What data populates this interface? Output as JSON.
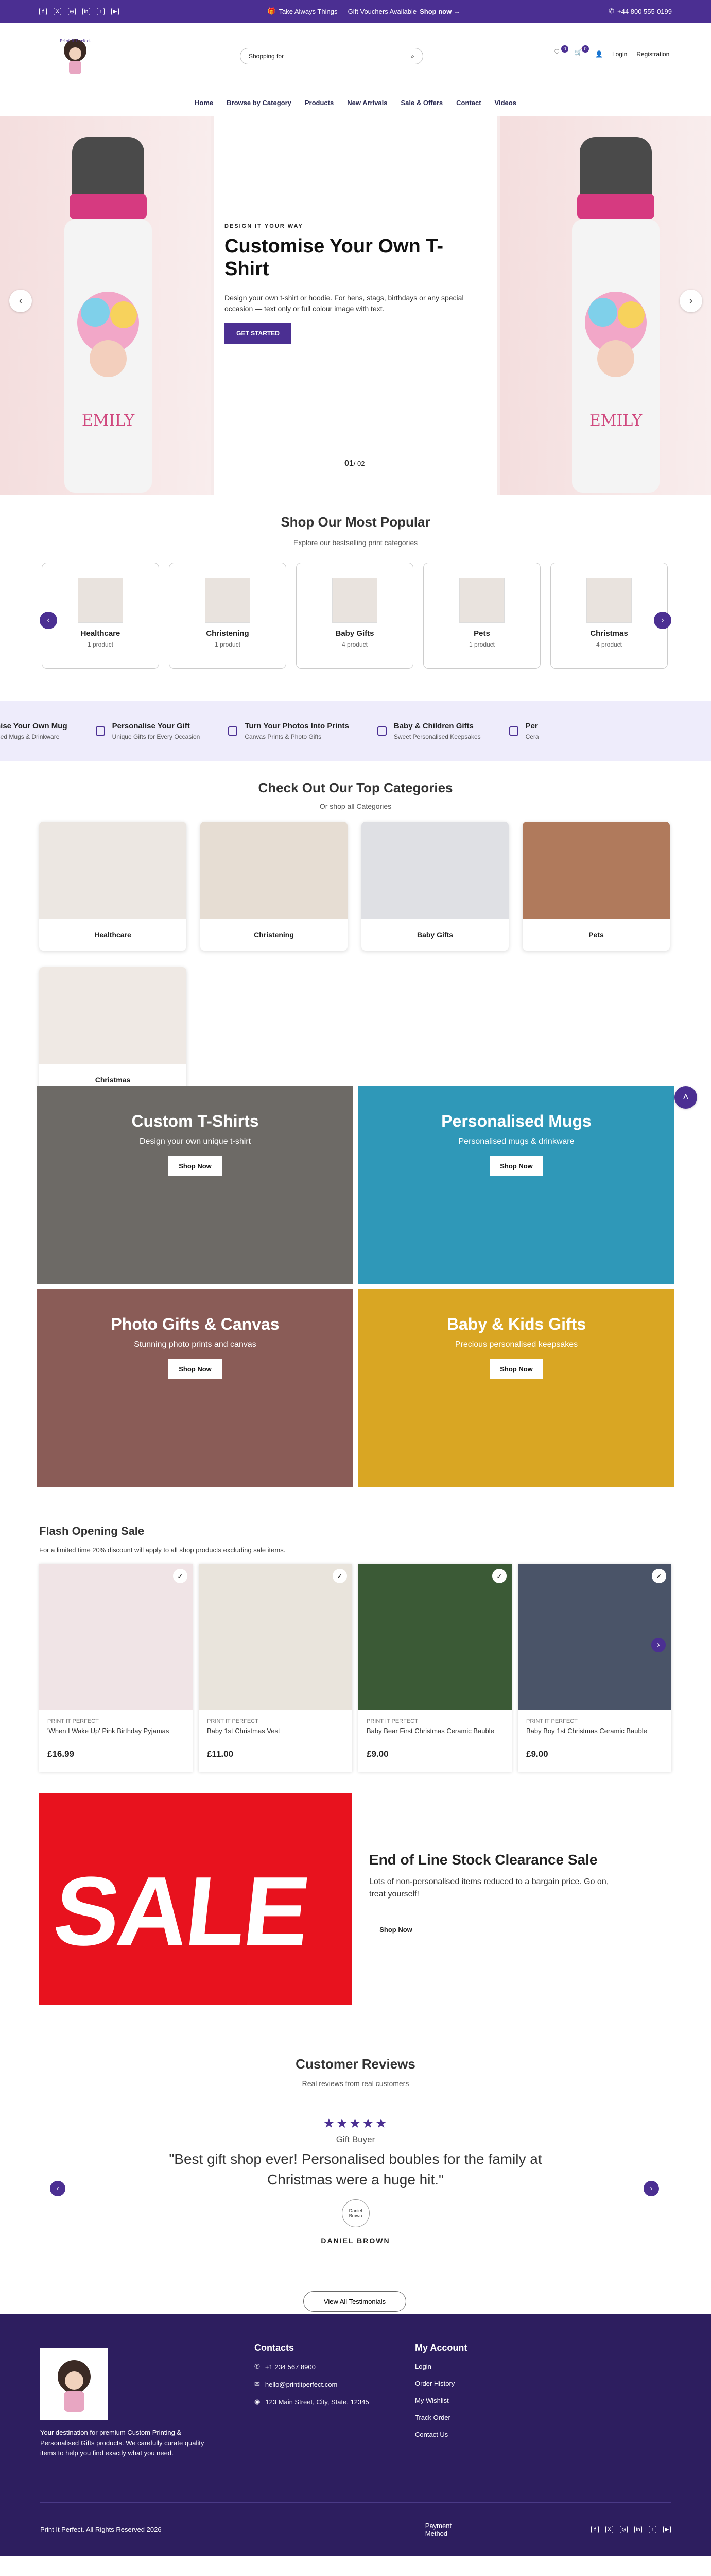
{
  "topbar": {
    "social": [
      "f",
      "X",
      "◎",
      "in",
      "♪",
      "▶"
    ],
    "promo": "Take Always Things — Gift Vouchers Available",
    "promo_link": "Shop now →",
    "phone": "+44 800 555-0199"
  },
  "header": {
    "search_placeholder": "Shopping for",
    "wishlist_count": "0",
    "cart_count": "0",
    "login": "Login",
    "register": "Registration"
  },
  "nav": [
    "Home",
    "Browse by Category",
    "Products",
    "New Arrivals",
    "Sale & Offers",
    "Contact",
    "Videos"
  ],
  "hero": {
    "kicker": "DESIGN IT YOUR WAY",
    "title": "Customise Your Own T-Shirt",
    "desc": "Design your own t-shirt or hoodie. For hens, stags, birthdays or any special occasion — text only or full colour image with text.",
    "cta": "GET STARTED",
    "counter_current": "01",
    "counter_total": "/ 02",
    "bottle_name": "EMILY"
  },
  "popular": {
    "title": "Shop Our Most Popular",
    "subtitle": "Explore our bestselling print categories",
    "items": [
      {
        "name": "Healthcare",
        "count": "1 product"
      },
      {
        "name": "Christening",
        "count": "1 product"
      },
      {
        "name": "Baby Gifts",
        "count": "4 product"
      },
      {
        "name": "Pets",
        "count": "1 product"
      },
      {
        "name": "Christmas",
        "count": "4 product"
      }
    ]
  },
  "marquee": [
    {
      "title": "nise Your Own Mug",
      "sub": "ised Mugs & Drinkware"
    },
    {
      "title": "Personalise Your Gift",
      "sub": "Unique Gifts for Every Occasion"
    },
    {
      "title": "Turn Your Photos Into Prints",
      "sub": "Canvas Prints & Photo Gifts"
    },
    {
      "title": "Baby & Children Gifts",
      "sub": "Sweet Personalised Keepsakes"
    },
    {
      "title": "Per",
      "sub": "Cera"
    }
  ],
  "topcats": {
    "title": "Check Out Our Top Categories",
    "subtitle": "Or shop all Categories",
    "items": [
      "Healthcare",
      "Christening",
      "Baby Gifts",
      "Pets",
      "Christmas"
    ]
  },
  "tiles": [
    {
      "title": "Custom T-Shirts",
      "desc": "Design your own unique t-shirt",
      "button": "Shop Now",
      "bg": "#6d6a66"
    },
    {
      "title": "Personalised Mugs",
      "desc": "Personalised mugs & drinkware",
      "button": "Shop Now",
      "bg": "#2f98b8"
    },
    {
      "title": "Photo Gifts & Canvas",
      "desc": "Stunning photo prints and canvas",
      "button": "Shop Now",
      "bg": "#8a5c57"
    },
    {
      "title": "Baby & Kids Gifts",
      "desc": "Precious personalised keepsakes",
      "button": "Shop Now",
      "bg": "#d9a623"
    }
  ],
  "flash": {
    "title": "Flash Opening Sale",
    "subtitle": "For a limited time 20% discount will apply to all shop products excluding sale items.",
    "products": [
      {
        "brand": "PRINT IT PERFECT",
        "name": "'When I Wake Up' Pink Birthday Pyjamas",
        "price": "£16.99"
      },
      {
        "brand": "PRINT IT PERFECT",
        "name": "Baby 1st Christmas Vest",
        "price": "£11.00"
      },
      {
        "brand": "PRINT IT PERFECT",
        "name": "Baby Bear First Christmas Ceramic Bauble",
        "price": "£9.00"
      },
      {
        "brand": "PRINT IT PERFECT",
        "name": "Baby Boy 1st Christmas Ceramic Bauble",
        "price": "£9.00"
      }
    ]
  },
  "clearance": {
    "image_word": "SALE",
    "title": "End of Line Stock Clearance Sale",
    "desc": "Lots of non-personalised items reduced to a bargain price. Go on, treat yourself!",
    "button": "Shop Now"
  },
  "reviews": {
    "title": "Customer Reviews",
    "subtitle": "Real reviews from real customers",
    "stars": "★★★★★",
    "role": "Gift Buyer",
    "quote": "\"Best gift shop ever! Personalised boubles for the family at Christmas were a huge hit.\"",
    "avatar_alt": "Daniel Brown",
    "name": "DANIEL BROWN",
    "button": "View All Testimonials"
  },
  "footer": {
    "about": "Your destination for premium Custom Printing & Personalised Gifts products. We carefully curate quality items to help you find exactly what you need.",
    "contacts_title": "Contacts",
    "phone": "+1 234 567 8900",
    "email": "hello@printitperfect.com",
    "address": "123 Main Street, City, State, 12345",
    "account_title": "My Account",
    "account_links": [
      "Login",
      "Order History",
      "My Wishlist",
      "Track Order",
      "Contact Us"
    ],
    "copyright": "Print It Perfect. All Rights Reserved 2026",
    "payment": "Payment Method"
  }
}
